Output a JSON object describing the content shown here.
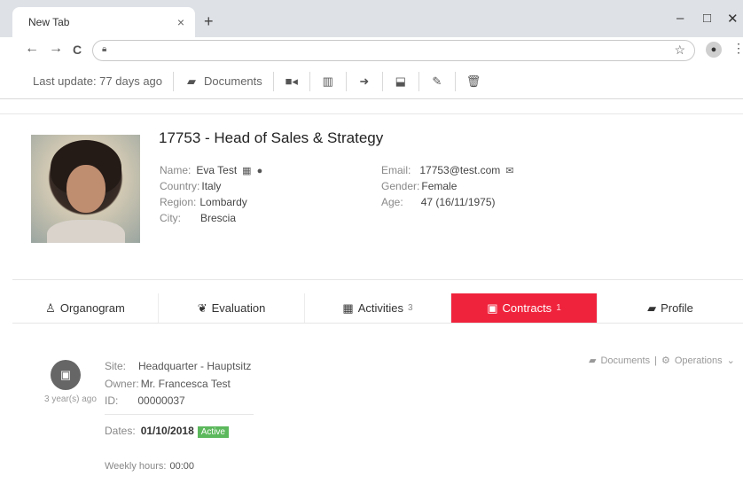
{
  "browser": {
    "tab_title": "New Tab",
    "tab_close": "×",
    "new_tab": "+",
    "minimize": "–",
    "maximize": "□",
    "close": "✕",
    "back": "←",
    "forward": "→",
    "reload": "C",
    "lock_icon": "lock-icon",
    "star": "☆",
    "menu": "⋮"
  },
  "actionbar": {
    "last_update": "Last update: 77 days ago",
    "documents": "Documents"
  },
  "profile": {
    "title": "17753 - Head of Sales & Strategy",
    "name_label": "Name:",
    "name_value": "Eva Test",
    "country_label": "Country:",
    "country_value": "Italy",
    "region_label": "Region:",
    "region_value": "Lombardy",
    "city_label": "City:",
    "city_value": "Brescia",
    "email_label": "Email:",
    "email_value": "17753@test.com",
    "gender_label": "Gender:",
    "gender_value": "Female",
    "age_label": "Age:",
    "age_value": "47 (16/11/1975)"
  },
  "tabs": [
    {
      "label": "Organogram",
      "count": ""
    },
    {
      "label": "Evaluation",
      "count": ""
    },
    {
      "label": "Activities",
      "count": "3"
    },
    {
      "label": "Contracts",
      "count": "1"
    },
    {
      "label": "Profile",
      "count": ""
    }
  ],
  "contract": {
    "ago": "3 year(s) ago",
    "site_label": "Site:",
    "site_value": "Headquarter - Hauptsitz",
    "owner_label": "Owner:",
    "owner_value": "Mr. Francesca Test",
    "id_label": "ID:",
    "id_value": "00000037",
    "dates_label": "Dates:",
    "dates_value": "01/10/2018",
    "status": "Active",
    "weekly_label": "Weekly hours:",
    "weekly_value": "00:00",
    "documents_link": "Documents",
    "operations_link": "Operations"
  },
  "colors": {
    "active_tab": "#f0233c",
    "active_badge": "#5cb85c"
  }
}
